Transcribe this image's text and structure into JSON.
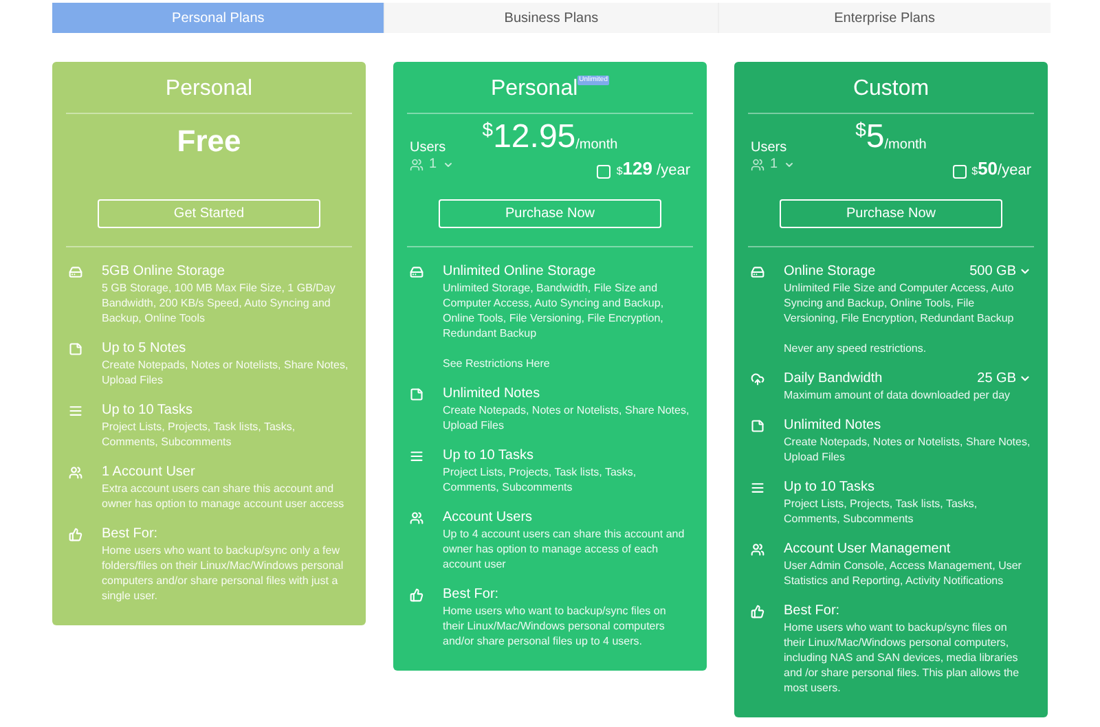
{
  "tabs": [
    {
      "label": "Personal Plans",
      "selected": true
    },
    {
      "label": "Business Plans",
      "selected": false
    },
    {
      "label": "Enterprise Plans",
      "selected": false
    }
  ],
  "plans": [
    {
      "color": "#abd072",
      "title": "Personal",
      "price_text": "Free",
      "button": "Get Started",
      "features": [
        {
          "kind": "storage",
          "title": "5GB Online Storage",
          "description": "5 GB Storage, 100 MB Max File Size, 1 GB/Day Bandwidth, 200 KB/s Speed, Auto Syncing and Backup, Online Tools"
        },
        {
          "kind": "notes",
          "title": "Up to 5 Notes",
          "description": "Create Notepads, Notes or Notelists, Share Notes, Upload Files"
        },
        {
          "kind": "tasks",
          "title": "Up to 10 Tasks",
          "description": "Project Lists, Projects, Task lists, Tasks, Comments, Subcomments"
        },
        {
          "kind": "users",
          "title": "1 Account User",
          "description": "Extra account users can share this account and owner has option to manage account user access"
        },
        {
          "kind": "best",
          "title": "Best For:",
          "description": "Home users who want to backup/sync only a few folders/files on their Linux/Mac/Windows personal computers and/or share personal files with just a single user."
        }
      ]
    },
    {
      "color": "#2bc275",
      "title": "Personal",
      "badge": "Unlimited",
      "currency": "$",
      "price": "12.95",
      "period": "/month",
      "users_label": "Users",
      "users_value": "1",
      "yearly": {
        "checked": false,
        "currency": "$",
        "price": "129",
        "period": " /year"
      },
      "button": "Purchase Now",
      "features": [
        {
          "kind": "storage",
          "title": "Unlimited Online Storage",
          "description": "Unlimited Storage, Bandwidth, File Size and Computer Access, Auto Syncing and Backup, Online Tools, File Versioning, File Encryption, Redundant Backup",
          "note": "See Restrictions Here"
        },
        {
          "kind": "notes",
          "title": "Unlimited Notes",
          "description": "Create Notepads, Notes or Notelists, Share Notes, Upload Files"
        },
        {
          "kind": "tasks",
          "title": "Up to 10 Tasks",
          "description": "Project Lists, Projects, Task lists, Tasks, Comments, Subcomments"
        },
        {
          "kind": "users",
          "title": "Account Users",
          "description": "Up to 4 account users can share this account and owner has option to manage access of each account user"
        },
        {
          "kind": "best",
          "title": "Best For:",
          "description": "Home users who want to backup/sync files on their Linux/Mac/Windows personal computers and/or share personal files up to 4 users."
        }
      ]
    },
    {
      "color": "#24ac66",
      "title": "Custom",
      "currency": "$",
      "price": "5",
      "period": "/month",
      "users_label": "Users",
      "users_value": "1",
      "yearly": {
        "checked": false,
        "currency": "$",
        "price": "50",
        "period": "/year"
      },
      "button": "Purchase Now",
      "features": [
        {
          "kind": "storage",
          "title": "Online Storage",
          "option": "500 GB",
          "description": "Unlimited File Size and Computer Access, Auto Syncing and Backup, Online Tools, File Versioning, File Encryption, Redundant Backup",
          "note": "Never any speed restrictions."
        },
        {
          "kind": "cloud",
          "title": "Daily Bandwidth",
          "option": "25 GB",
          "description": "Maximum amount of data downloaded per day"
        },
        {
          "kind": "notes",
          "title": "Unlimited Notes",
          "description": "Create Notepads, Notes or Notelists, Share Notes, Upload Files"
        },
        {
          "kind": "tasks",
          "title": "Up to 10 Tasks",
          "description": "Project Lists, Projects, Task lists, Tasks, Comments, Subcomments"
        },
        {
          "kind": "users",
          "title": "Account User Management",
          "description": "User Admin Console, Access Management, User Statistics and Reporting, Activity Notifications"
        },
        {
          "kind": "best",
          "title": "Best For:",
          "description": "Home users who want to backup/sync files on their Linux/Mac/Windows personal computers, including NAS and SAN devices, media libraries and /or share personal files. This plan allows the most users."
        }
      ]
    }
  ]
}
